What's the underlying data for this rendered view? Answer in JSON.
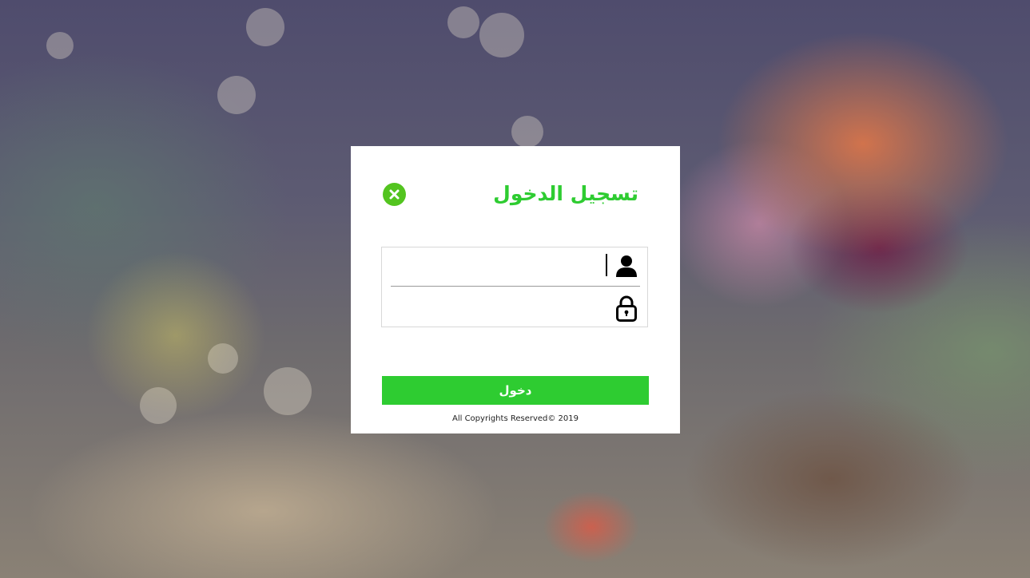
{
  "login": {
    "title": "تسجيل الدخول",
    "username_value": "",
    "username_placeholder": "",
    "password_value": "",
    "password_placeholder": "",
    "submit_label": "دخول",
    "copyright": "All Copyrights Reserved© 2019"
  },
  "icons": {
    "close": "close-circle-icon",
    "user": "user-icon",
    "lock": "lock-icon"
  },
  "colors": {
    "accent": "#2ecc31",
    "close_button": "#53c41f",
    "card_background": "#ffffff"
  }
}
